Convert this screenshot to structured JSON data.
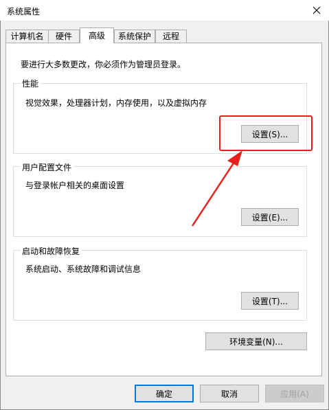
{
  "window": {
    "title": "系统属性"
  },
  "tabs": [
    {
      "label": "计算机名"
    },
    {
      "label": "硬件"
    },
    {
      "label": "高级",
      "active": true
    },
    {
      "label": "系统保护"
    },
    {
      "label": "远程"
    }
  ],
  "intro": "要进行大多数更改，你必须作为管理员登录。",
  "performance": {
    "title": "性能",
    "desc": "视觉效果，处理器计划，内存使用，以及虚拟内存",
    "button": "设置(S)..."
  },
  "profiles": {
    "title": "用户配置文件",
    "desc": "与登录帐户相关的桌面设置",
    "button": "设置(E)..."
  },
  "startup": {
    "title": "启动和故障恢复",
    "desc": "系统启动、系统故障和调试信息",
    "button": "设置(T)..."
  },
  "env_button": "环境变量(N)...",
  "footer": {
    "ok": "确定",
    "cancel": "取消",
    "apply": "应用(A)"
  },
  "colors": {
    "annotation": "#e6201b",
    "focus": "#0078d7"
  },
  "icons": {
    "close": "close-icon"
  }
}
